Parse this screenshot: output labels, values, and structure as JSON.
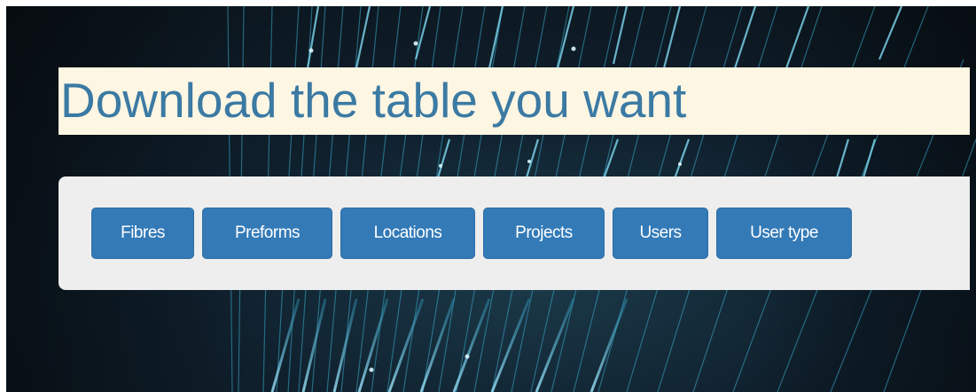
{
  "page": {
    "title": "Download the table you want"
  },
  "tables": {
    "buttons": [
      {
        "label": "Fibres"
      },
      {
        "label": "Preforms"
      },
      {
        "label": "Locations"
      },
      {
        "label": "Projects"
      },
      {
        "label": "Users"
      },
      {
        "label": "User type"
      }
    ]
  },
  "colors": {
    "title_text": "#3b7aa3",
    "title_band": "#fdf6e3",
    "button_bg": "#337ab7",
    "panel_bg": "#eeeeee",
    "background": "#0f1f2c"
  },
  "background": {
    "image": "fibre-optic-strands"
  }
}
